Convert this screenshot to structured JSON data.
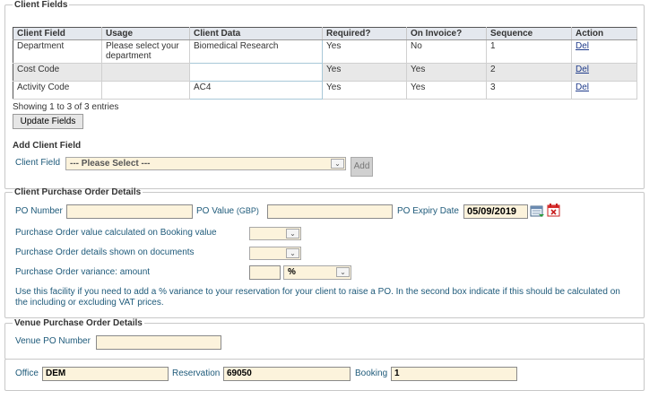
{
  "client_fields": {
    "legend": "Client Fields",
    "columns": [
      "Client Field",
      "Usage",
      "Client Data",
      "Required?",
      "On Invoice?",
      "Sequence",
      "Action"
    ],
    "rows": [
      {
        "field": "Department",
        "usage": "Please select your department",
        "data": "Biomedical Research",
        "required": "Yes",
        "invoice": "No",
        "sequence": "1",
        "action": "Del"
      },
      {
        "field": "Cost Code",
        "usage": "",
        "data": "",
        "required": "Yes",
        "invoice": "Yes",
        "sequence": "2",
        "action": "Del"
      },
      {
        "field": "Activity Code",
        "usage": "",
        "data": "AC4",
        "required": "Yes",
        "invoice": "Yes",
        "sequence": "3",
        "action": "Del"
      }
    ],
    "showing": "Showing 1 to 3 of 3 entries",
    "update_button": "Update Fields"
  },
  "add_client_field": {
    "heading": "Add Client Field",
    "label": "Client Field",
    "select_value": "--- Please Select ---",
    "add_button": "Add"
  },
  "purchase_order": {
    "legend": "Client Purchase Order Details",
    "po_number_label": "PO Number",
    "po_number_value": "",
    "po_value_label": "PO Value",
    "po_value_unit": "(GBP)",
    "po_value_value": "",
    "po_expiry_label": "PO Expiry Date",
    "po_expiry_value": "05/09/2019",
    "calc_label": "Purchase Order value calculated on Booking value",
    "shown_label": "Purchase Order details shown on documents",
    "variance_label": "Purchase Order variance: amount",
    "variance_unit": "%",
    "note": "Use this facility if you need to add a % variance to your reservation for your client to raise a PO. In the second box indicate if this should be calculated on the including or excluding VAT prices."
  },
  "venue_po": {
    "legend": "Venue Purchase Order Details",
    "label": "Venue PO Number",
    "value": ""
  },
  "footer": {
    "office_label": "Office",
    "office_value": "DEM",
    "reservation_label": "Reservation",
    "reservation_value": "69050",
    "booking_label": "Booking",
    "booking_value": "1"
  },
  "colors": {
    "accent": "#1e5a7a",
    "input_bg": "#fcf3dc",
    "header_bg": "#e4e8ee"
  }
}
